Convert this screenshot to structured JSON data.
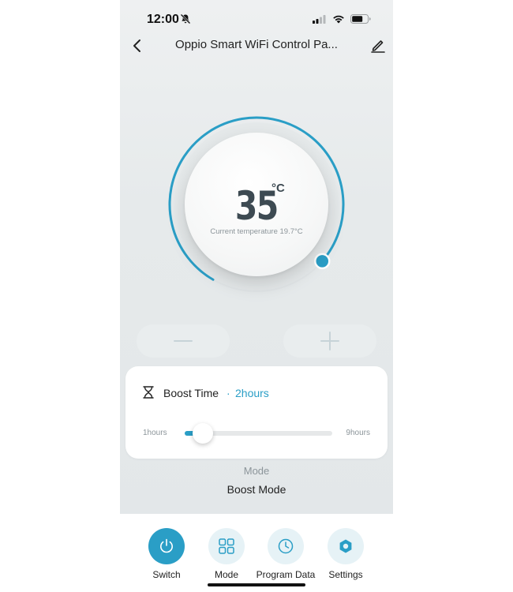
{
  "status_bar": {
    "time": "12:00",
    "icons": [
      "bell-slash-icon",
      "signal-icon",
      "wifi-icon",
      "battery-icon"
    ]
  },
  "header": {
    "title": "Oppio Smart WiFi Control Pa...",
    "back_icon": "chevron-left-icon",
    "edit_icon": "pencil-icon"
  },
  "dial": {
    "setpoint": "35",
    "unit": "°C",
    "current_label": "Current temperature 19.7°C",
    "arc_fraction": 0.78,
    "accent": "#2a9ec6"
  },
  "controls": {
    "minus_icon": "minus-icon",
    "plus_icon": "plus-icon"
  },
  "boost": {
    "label": "Boost Time",
    "separator": "·",
    "value": "2hours",
    "slider": {
      "min_label": "1hours",
      "max_label": "9hours",
      "min": 1,
      "max": 9,
      "value": 2
    }
  },
  "mode": {
    "caption": "Mode",
    "value": "Boost Mode"
  },
  "bottom_nav": [
    {
      "label": "Switch",
      "icon": "power-icon",
      "active": true
    },
    {
      "label": "Mode",
      "icon": "grid-icon",
      "active": false
    },
    {
      "label": "Program Data",
      "icon": "clock-icon",
      "active": false
    },
    {
      "label": "Settings",
      "icon": "settings-hexagon-icon",
      "active": false
    }
  ],
  "colors": {
    "accent": "#2a9ec6",
    "background": "#e6eaeb",
    "text": "#222222",
    "muted": "#8c959a"
  }
}
